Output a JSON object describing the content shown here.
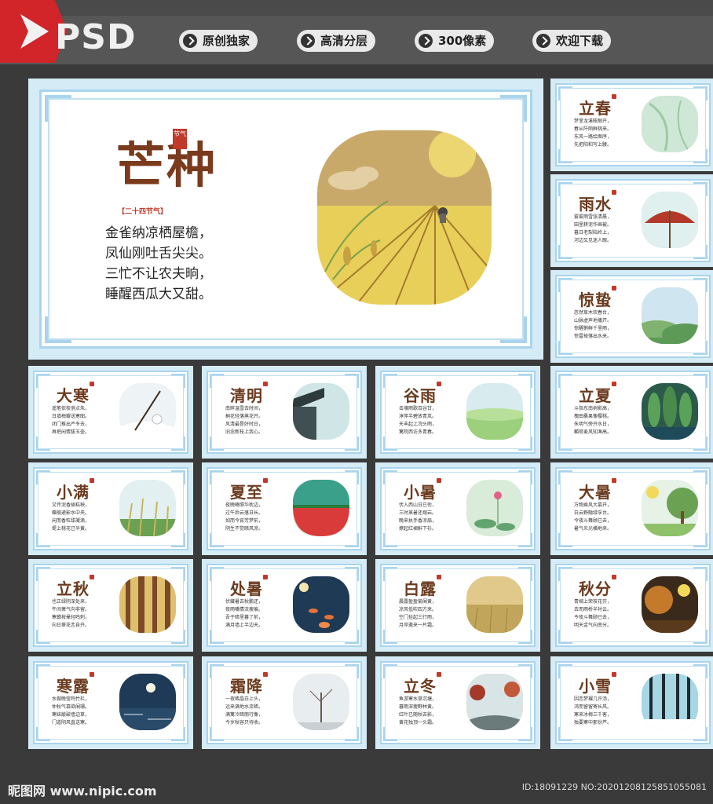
{
  "header": {
    "logo": "PSD",
    "pills": [
      "原创独家",
      "高清分层",
      "300像素",
      "欢迎下载"
    ]
  },
  "featured": {
    "title": "芒种",
    "seal": "节气",
    "tag": "【二十四节气】",
    "poem": [
      "金雀纳凉栖屋檐，",
      "凤仙刚吐舌尖尖。",
      "三忙不让农夫晌，",
      "睡醒西瓜大又甜。"
    ]
  },
  "cards": [
    {
      "title": "立春",
      "poem": [
        "梦里龙溪眩眼开，",
        "春从阡陌鲜桃来。",
        "东风一路绘图序，",
        "先把阳和写上腰。"
      ]
    },
    {
      "title": "雨水",
      "poem": [
        "雾雾雨雪涨清晨，",
        "田里耕泥作画被。",
        "暮日老梨陆岭上，",
        "河边又见迷人眼。"
      ]
    },
    {
      "title": "惊蛰",
      "poem": [
        "忽然草木欢春台，",
        "山脉虚声地播开。",
        "惊醒鹅鲜千里雨，",
        "惊雷掉落出水来。"
      ]
    },
    {
      "title": "大寒",
      "poem": [
        "遥笔依枝俏点朱，",
        "日填梅瓣送寒图。",
        "闭门推出严冬去，",
        "再把闲情拔玉壶。"
      ]
    },
    {
      "title": "清明",
      "poem": [
        "南畔温雪去时间，",
        "桐花轻落蒸花开。",
        "风清最是好时日，",
        "旧念新枝上我心。"
      ]
    },
    {
      "title": "谷雨",
      "poem": [
        "击壤雨歌百谷甘，",
        "淳萍半碧放青岚。",
        "天丰起上浣头雨，",
        "篱院西访多青春。"
      ]
    },
    {
      "title": "立夏",
      "poem": [
        "斗指东南树影高，",
        "槐田桑果像樱桃。",
        "朱明气旁开水日，",
        "麟荷麦风知渔高。"
      ]
    },
    {
      "title": "小满",
      "poem": [
        "又传泥香插秸秧，",
        "蝶舰递影水中央。",
        "闲而香粒甜凝滴，",
        "堤上桃花已半黄。"
      ]
    },
    {
      "title": "夏至",
      "poem": [
        "夜晚曦照华枕边，",
        "过午后云落日长。",
        "如而今宵芳梦前，",
        "阴生不觉暗风凉。"
      ]
    },
    {
      "title": "小暑",
      "poem": [
        "伏入西山日已衔，",
        "三时蒸暑还熔岩。",
        "晚来执手香凉扇，",
        "撩起红裙斛下衫。"
      ]
    },
    {
      "title": "大暑",
      "poem": [
        "万物乘风大慕开，",
        "白云野融绿孚台。",
        "今夜斗舞顾已去，",
        "暑气炎光横地来。"
      ]
    },
    {
      "title": "立秋",
      "poem": [
        "也正绿阴深处来，",
        "午间萧气向非留。",
        "寒蝉按晕轻鸣刺，",
        "向日葵花恋自开。"
      ]
    },
    {
      "title": "处暑",
      "poem": [
        "伏藏暑去秋鹏还，",
        "夜雨嘴情流瘦痕。",
        "吾于暗里暮了前，",
        "满月墙上半边天。"
      ]
    },
    {
      "title": "白露",
      "poem": [
        "晨露盈盈菊阑黄，",
        "凉风低吹四方来。",
        "空门挂起三行雨，",
        "月岸邀来一片霜。"
      ]
    },
    {
      "title": "秋分",
      "poem": [
        "青绸上荣枝花芬，",
        "去而雨桥半衬云。",
        "今夜斗舞顾已去，",
        "明天金气向南分。"
      ]
    },
    {
      "title": "寒露",
      "poem": [
        "水做晚莹鸣竹栏，",
        "仲秋气慕欲阑珊。",
        "寒妹敲破墙边草，",
        "门道阴风直送寒。"
      ]
    },
    {
      "title": "霜降",
      "poem": [
        "一夜稀晶白上头，",
        "远来满地水流稀。",
        "满篱冷暗丽行像，",
        "今岁秋容只待收。"
      ]
    },
    {
      "title": "立冬",
      "poem": [
        "鱼游寒水草沉塘，",
        "暮雨深瘦野林黄。",
        "红叶已随秋去影，",
        "黄花独顶一头霜。"
      ]
    },
    {
      "title": "小雪",
      "poem": [
        "因恋梦裸几许汤，",
        "鸿而留留寄长风。",
        "寒来冰梅三千客，",
        "独要寒中那份芦。"
      ]
    }
  ],
  "footer": {
    "watermark_left": "昵图网 www.nipic.com",
    "watermark_right": "ID:18091229 NO:20201208125851055081"
  }
}
